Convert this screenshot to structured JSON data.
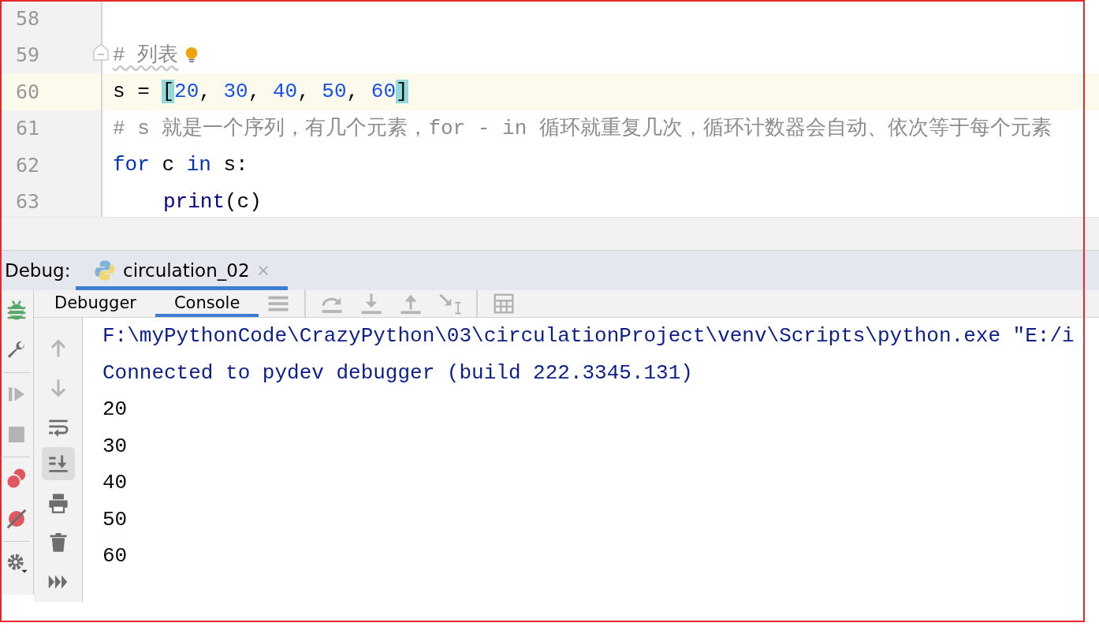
{
  "editor": {
    "lines": [
      {
        "number": "58",
        "current": false,
        "fold": false,
        "intention_bulb": false
      },
      {
        "number": "59",
        "current": false,
        "fold": true,
        "intention_bulb": true,
        "tokens": [
          {
            "text": "# 列表",
            "kind": "comment"
          }
        ]
      },
      {
        "number": "60",
        "current": true,
        "fold": false,
        "intention_bulb": false,
        "tokens": [
          {
            "text": "s = ",
            "kind": "plain"
          },
          {
            "text": "[",
            "kind": "brace_match"
          },
          {
            "text": "20",
            "kind": "number"
          },
          {
            "text": ", ",
            "kind": "plain"
          },
          {
            "text": "30",
            "kind": "number"
          },
          {
            "text": ", ",
            "kind": "plain"
          },
          {
            "text": "40",
            "kind": "number"
          },
          {
            "text": ", ",
            "kind": "plain"
          },
          {
            "text": "50",
            "kind": "number"
          },
          {
            "text": ", ",
            "kind": "plain"
          },
          {
            "text": "60",
            "kind": "number"
          },
          {
            "text": "]",
            "kind": "brace_match"
          }
        ]
      },
      {
        "number": "61",
        "current": false,
        "fold": false,
        "intention_bulb": false,
        "tokens": [
          {
            "text": "# s 就是一个序列，有几个元素，for - in 循环就重复几次，循环计数器会自动、依次等于每个元素",
            "kind": "comment"
          }
        ]
      },
      {
        "number": "62",
        "current": false,
        "fold": false,
        "intention_bulb": false,
        "tokens": [
          {
            "text": "for",
            "kind": "keyword"
          },
          {
            "text": " c ",
            "kind": "plain"
          },
          {
            "text": "in",
            "kind": "keyword"
          },
          {
            "text": " s:",
            "kind": "plain"
          }
        ]
      },
      {
        "number": "63",
        "current": false,
        "fold": false,
        "intention_bulb": false,
        "indented": true,
        "tokens": [
          {
            "text": "print",
            "kind": "builtin"
          },
          {
            "text": "(c)",
            "kind": "plain"
          }
        ]
      }
    ]
  },
  "debug_panel": {
    "label": "Debug:",
    "run_tabs": [
      {
        "title": "circulation_02",
        "selected": true
      }
    ],
    "tabs": [
      {
        "label": "Debugger",
        "selected": false
      },
      {
        "label": "Console",
        "selected": true
      }
    ],
    "console": [
      {
        "text": "F:\\myPythonCode\\CrazyPython\\03\\circulationProject\\venv\\Scripts\\python.exe \"E:/i",
        "kind": "system"
      },
      {
        "text": "Connected to pydev debugger (build 222.3345.131)",
        "kind": "system"
      },
      {
        "text": "20",
        "kind": "output"
      },
      {
        "text": "30",
        "kind": "output"
      },
      {
        "text": "40",
        "kind": "output"
      },
      {
        "text": "50",
        "kind": "output"
      },
      {
        "text": "60",
        "kind": "output"
      }
    ],
    "scroll_to_end": {
      "on": true
    }
  }
}
